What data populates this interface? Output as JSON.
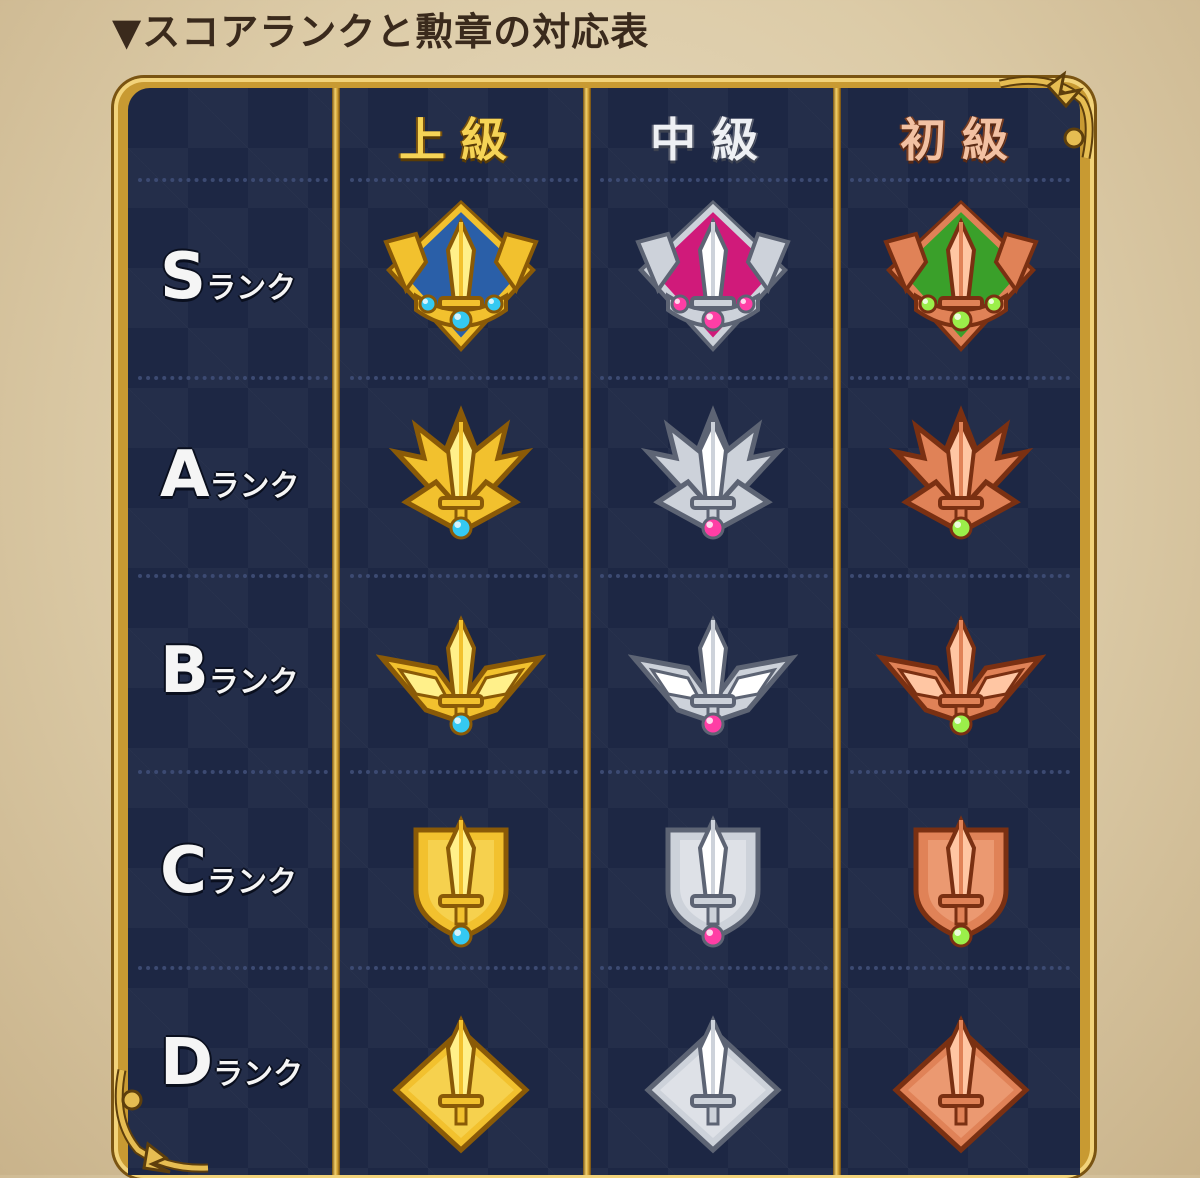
{
  "heading": "▼スコアランクと勲章の対応表",
  "columns": [
    {
      "label": "上級",
      "tier": "gold"
    },
    {
      "label": "中級",
      "tier": "silver"
    },
    {
      "label": "初級",
      "tier": "bronze"
    }
  ],
  "rows": [
    {
      "letter": "S",
      "suffix": "ランク",
      "shape": "s"
    },
    {
      "letter": "A",
      "suffix": "ランク",
      "shape": "a"
    },
    {
      "letter": "B",
      "suffix": "ランク",
      "shape": "b"
    },
    {
      "letter": "C",
      "suffix": "ランク",
      "shape": "c"
    },
    {
      "letter": "D",
      "suffix": "ランク",
      "shape": "d"
    }
  ],
  "colors": {
    "panel": "#1d2744",
    "frame_gold": "#c89a32",
    "gold": {
      "main": "#f2c12e",
      "light": "#fff08a",
      "dark": "#8a5a07",
      "gem": "#35c9f2",
      "inner": "#2a5fa8"
    },
    "silver": {
      "main": "#cdd2da",
      "light": "#ffffff",
      "dark": "#5d6474",
      "gem": "#ff3ea5",
      "inner": "#d01a7a"
    },
    "bronze": {
      "main": "#e08257",
      "light": "#ffc6a3",
      "dark": "#7a3012",
      "gem": "#9bef4a",
      "inner": "#3aa02a"
    }
  }
}
